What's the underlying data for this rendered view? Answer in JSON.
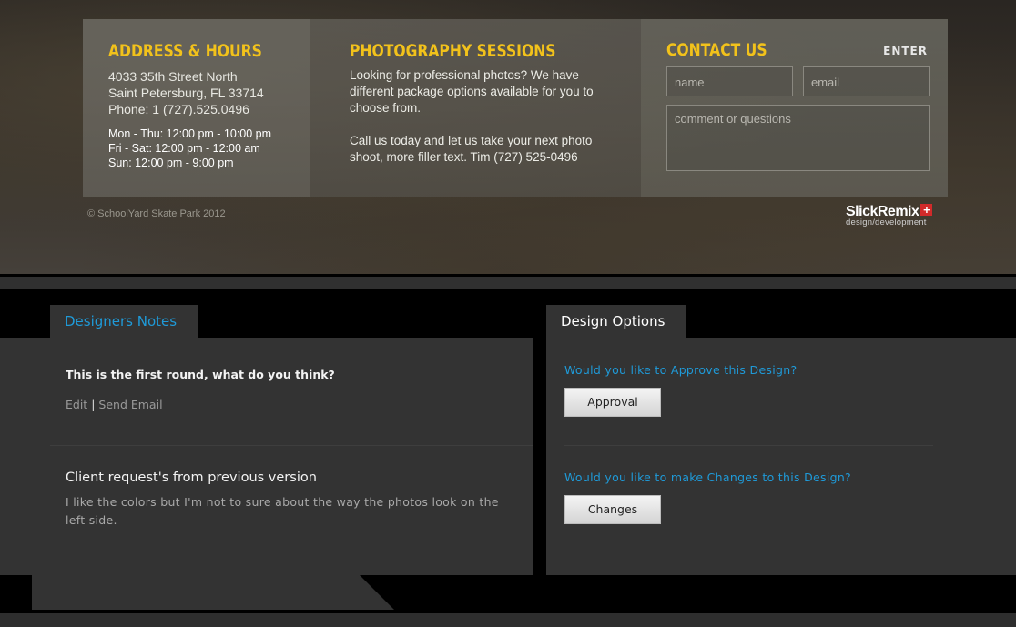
{
  "footer": {
    "address": {
      "heading": "ADDRESS & HOURS",
      "street": "4033 35th Street North",
      "city": "Saint Petersburg, FL 33714",
      "phone": "Phone: 1 (727).525.0496",
      "hours": [
        "Mon - Thu: 12:00 pm - 10:00 pm",
        "Fri - Sat: 12:00 pm - 12:00 am",
        "Sun: 12:00 pm - 9:00 pm"
      ]
    },
    "photography": {
      "heading": "PHOTOGRAPHY SESSIONS",
      "paragraph1": "Looking for professional photos? We have different package options available for you to choose from.",
      "paragraph2": "Call us today and let us take your next photo shoot, more filler text. Tim (727) 525-0496"
    },
    "contact": {
      "heading": "CONTACT US",
      "enter_label": "ENTER",
      "name_placeholder": "name",
      "email_placeholder": "email",
      "comment_placeholder": "comment or questions"
    },
    "copyright": "© SchoolYard Skate Park 2012",
    "brand": {
      "name": "SlickRemix",
      "cross": "+",
      "tagline": "design/development"
    }
  },
  "notes": {
    "tab_label": "Designers Notes",
    "first_note": "This is the first round, what do you think?",
    "edit_label": "Edit",
    "separator": "|",
    "send_email_label": "Send Email",
    "request_title": "Client request's from previous version",
    "request_text": "I like the colors but I'm not to sure about the way the photos look on the left side."
  },
  "options": {
    "tab_label": "Design Options",
    "approve_question": "Would you like to Approve this Design?",
    "approve_button": "Approval",
    "changes_question": "Would you like to make Changes to this Design?",
    "changes_button": "Changes"
  },
  "colors": {
    "accent_yellow": "#f2c21b",
    "accent_blue": "#1f9ad8",
    "panel_bg": "#333333",
    "brand_red": "#d12a2a"
  }
}
